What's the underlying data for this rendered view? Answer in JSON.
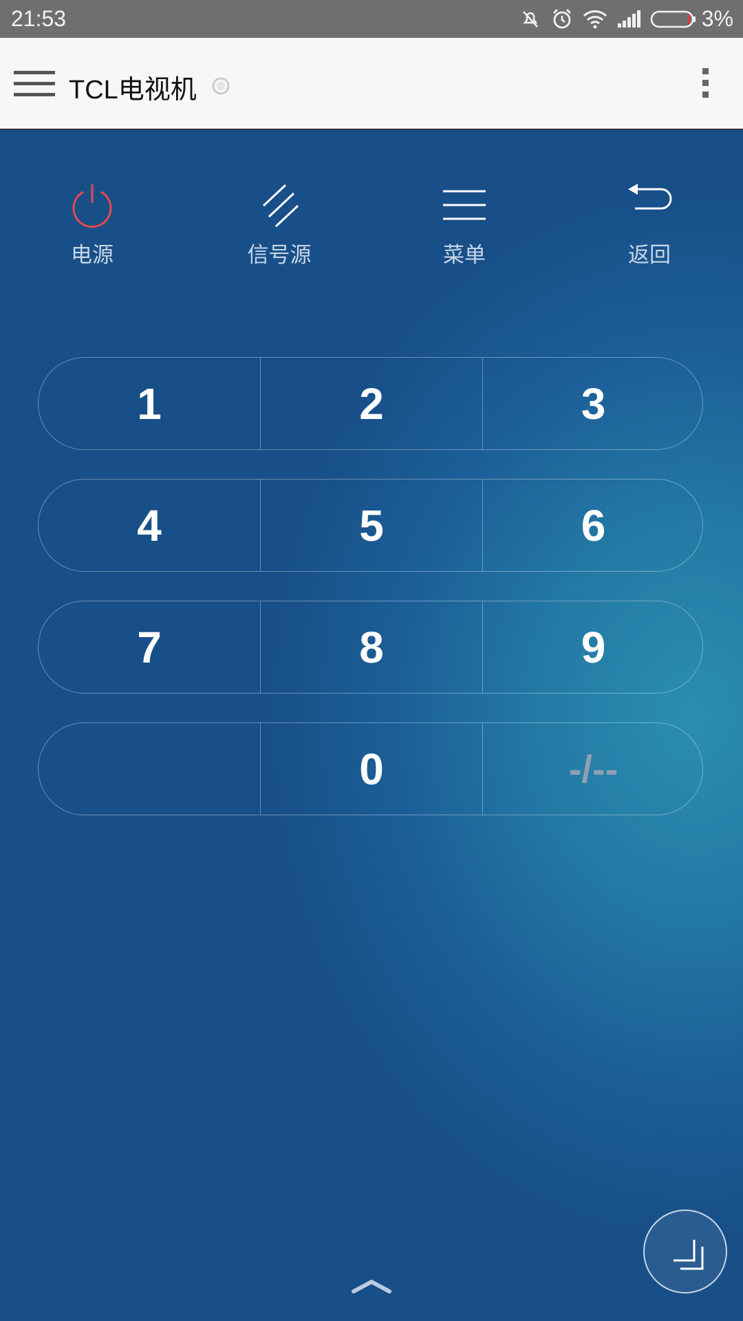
{
  "status_bar": {
    "time": "21:53",
    "battery_percent": "3%",
    "icons": [
      "mute-notification-icon",
      "alarm-icon",
      "wifi-icon",
      "signal-icon",
      "battery-icon"
    ]
  },
  "app_bar": {
    "title": "TCL电视机",
    "icons": [
      "hamburger-menu-icon",
      "connection-status-icon",
      "overflow-menu-icon"
    ]
  },
  "controls": [
    {
      "label": "电源",
      "icon": "power-icon",
      "color": "#e8474f"
    },
    {
      "label": "信号源",
      "icon": "source-icon"
    },
    {
      "label": "菜单",
      "icon": "menu-icon"
    },
    {
      "label": "返回",
      "icon": "back-icon"
    }
  ],
  "keypad": {
    "rows": [
      [
        "1",
        "2",
        "3"
      ],
      [
        "4",
        "5",
        "6"
      ],
      [
        "7",
        "8",
        "9"
      ],
      [
        "",
        "0",
        "-/--"
      ]
    ]
  },
  "bottom": {
    "chevron_icon": "chevron-up-icon",
    "fab_icon": "resize-icon"
  }
}
